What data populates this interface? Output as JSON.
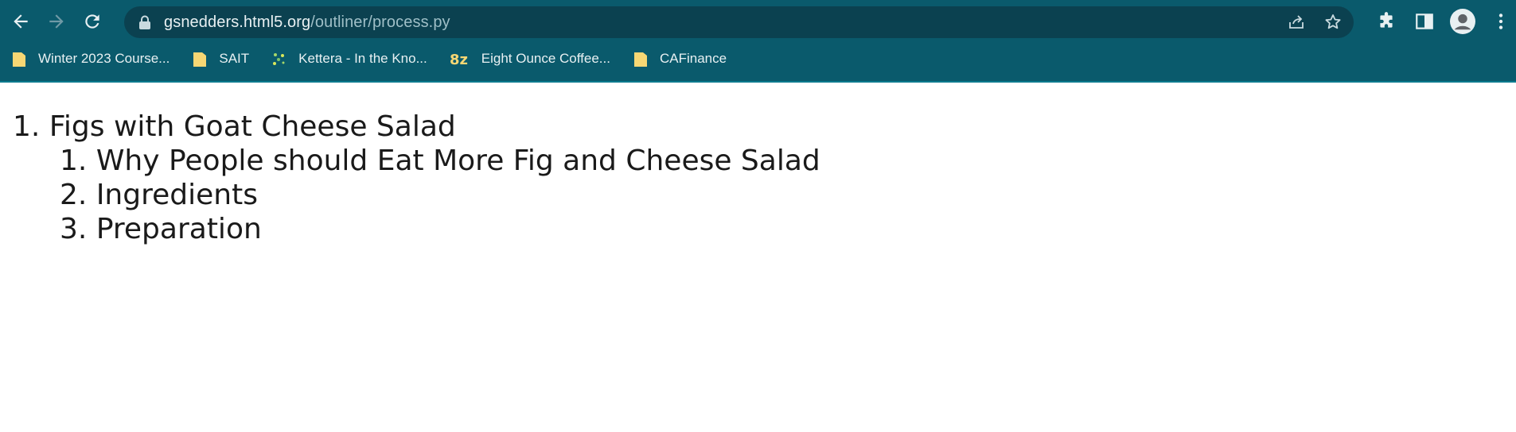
{
  "browser": {
    "url_host": "gsnedders.html5.org",
    "url_path": "/outliner/process.py",
    "nav": {
      "back": "back-arrow-icon",
      "forward": "forward-arrow-icon",
      "reload": "reload-icon"
    },
    "colors": {
      "chrome": "#0a5a6c",
      "omnibox": "#0b4150",
      "text": "#e8f0f2"
    }
  },
  "bookmarks": [
    {
      "label": "Winter 2023 Course...",
      "icon": "folder-icon"
    },
    {
      "label": "SAIT",
      "icon": "folder-icon"
    },
    {
      "label": "Kettera - In the Kno...",
      "icon": "kettera-favicon"
    },
    {
      "label": "Eight Ounce Coffee...",
      "icon": "eight-ounce-favicon"
    },
    {
      "label": "CAFinance",
      "icon": "folder-icon"
    }
  ],
  "outline": {
    "top": {
      "number": "1.",
      "text": "Figs with Goat Cheese Salad"
    },
    "children": [
      {
        "number": "1.",
        "text": "Why People should Eat More Fig and Cheese Salad"
      },
      {
        "number": "2.",
        "text": "Ingredients"
      },
      {
        "number": "3.",
        "text": "Preparation"
      }
    ]
  }
}
